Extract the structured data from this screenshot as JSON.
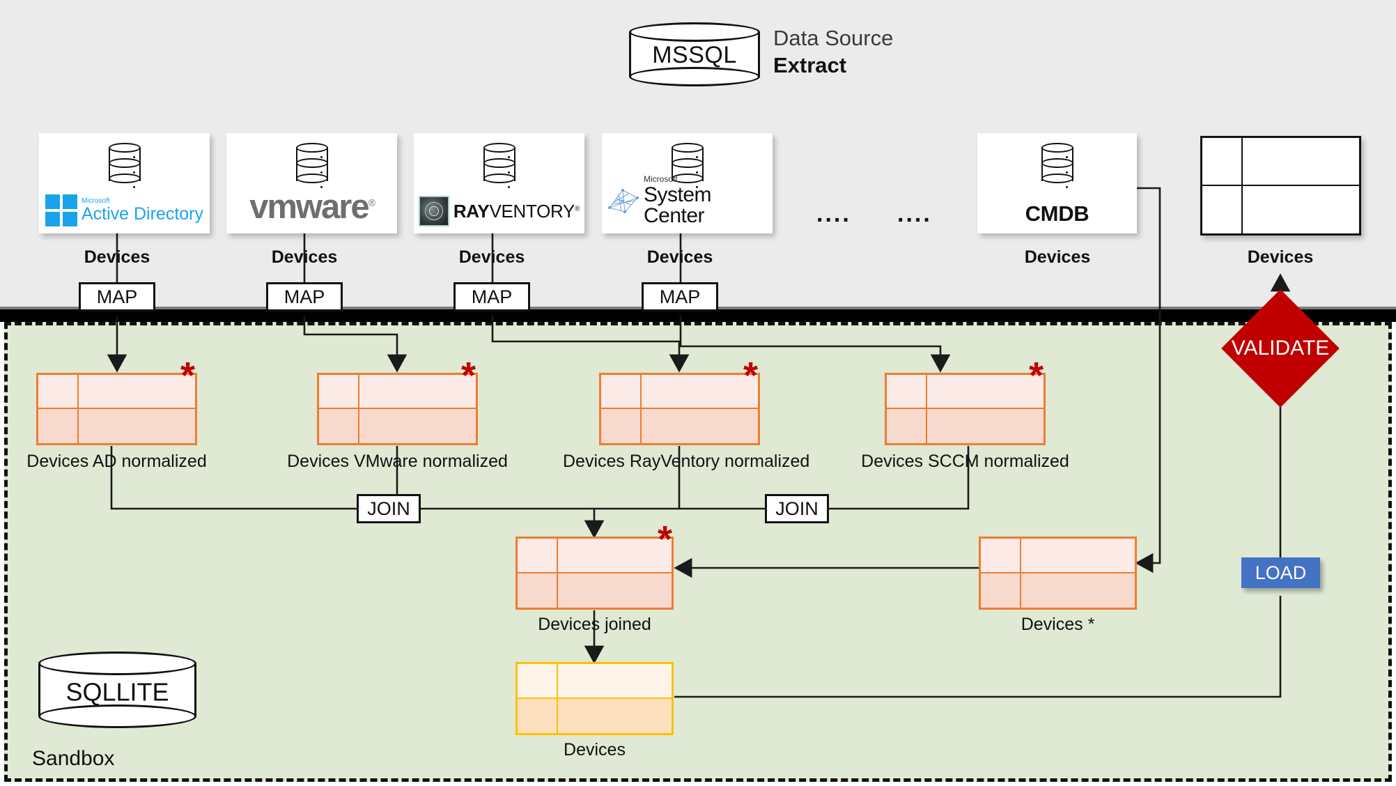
{
  "header": {
    "source_db_label": "MSSQL",
    "data_source_text": "Data Source",
    "extract_text": "Extract"
  },
  "sources": [
    {
      "name": "Active Directory",
      "vendor_small": "Microsoft",
      "vendor_big": "Active Directory",
      "table_label": "Devices",
      "op": "MAP"
    },
    {
      "name": "VMware",
      "vendor_big": "vmware",
      "table_label": "Devices",
      "op": "MAP"
    },
    {
      "name": "RayVentory",
      "vendor_bold": "RAY",
      "vendor_light": "VENTORY",
      "table_label": "Devices",
      "op": "MAP"
    },
    {
      "name": "System Center",
      "vendor_small": "Microsoft",
      "vendor_big": "System Center",
      "table_label": "Devices",
      "op": "MAP"
    },
    {
      "name": "CMDB",
      "vendor_big": "CMDB",
      "table_label": "Devices"
    },
    {
      "name": "Target table",
      "table_label": "Devices"
    }
  ],
  "ellipsis": {
    "left": "....",
    "right": "...."
  },
  "sandbox": {
    "db_label": "SQLLITE",
    "zone_label": "Sandbox",
    "normalized_tables": [
      {
        "label": "Devices AD normalized",
        "flag": "*"
      },
      {
        "label": "Devices VMware normalized",
        "flag": "*"
      },
      {
        "label": "Devices RayVentory normalized",
        "flag": "*"
      },
      {
        "label": "Devices SCCM normalized",
        "flag": "*"
      }
    ],
    "join_left_label": "JOIN",
    "join_right_label": "JOIN",
    "joined_table": {
      "label": "Devices joined",
      "flag": "*"
    },
    "cmdb_table": {
      "label": "Devices *"
    },
    "output_table": {
      "label": "Devices"
    }
  },
  "operations": {
    "validate_label": "VALIDATE",
    "load_label": "LOAD"
  },
  "colors": {
    "extract_bg": "#ebebeb",
    "sandbox_bg": "#dfe9d3",
    "validate": "#c00000",
    "load": "#4472c4",
    "table_orange": "#ed7d31",
    "table_yellow": "#ffc000",
    "ad_blue": "#19a3ec"
  }
}
